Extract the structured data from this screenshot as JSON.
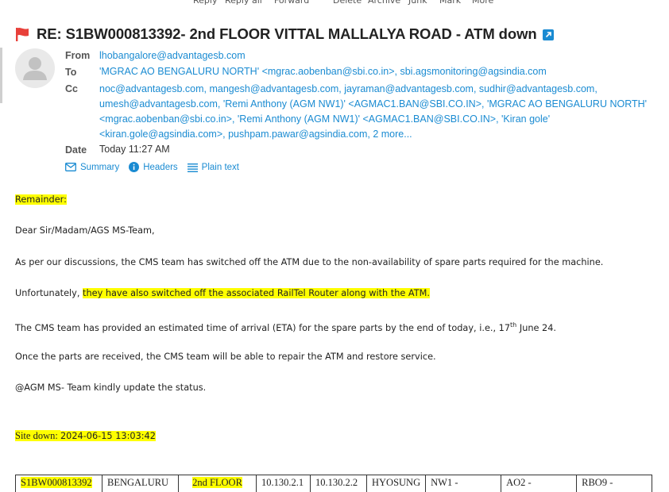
{
  "toolbar": {
    "reply": "Reply",
    "reply_all": "Reply all",
    "forward": "Forward",
    "delete": "Delete",
    "archive": "Archive",
    "junk": "Junk",
    "mark": "Mark",
    "more": "More"
  },
  "message": {
    "subject": "RE: S1BW000813392- 2nd FLOOR VITTAL MALLALYA ROAD - ATM down",
    "from_label": "From",
    "from": "lhobangalore@advantagesb.com",
    "to_label": "To",
    "to": "'MGRAC AO BENGALURU NORTH' <mgrac.aobenban@sbi.co.in>, sbi.agsmonitoring@agsindia.com",
    "cc_label": "Cc",
    "cc_lines": [
      "noc@advantagesb.com, mangesh@advantagesb.com, jayraman@advantagesb.com, sudhir@advantagesb.com,",
      "umesh@advantagesb.com, 'Remi Anthony (AGM NW1)' <AGMAC1.BAN@SBI.CO.IN>, 'MGRAC AO BENGALURU NORTH'",
      "<mgrac.aobenban@sbi.co.in>, 'Remi Anthony (AGM NW1)' <AGMAC1.BAN@SBI.CO.IN>, 'Kiran gole'",
      "<kiran.gole@agsindia.com>, pushpam.pawar@agsindia.com,"
    ],
    "cc_more": "2 more...",
    "date_label": "Date",
    "date": "Today 11:27 AM",
    "links": {
      "summary": "Summary",
      "headers": "Headers",
      "plain_text": "Plain text"
    }
  },
  "body": {
    "remainder": "Remainder:",
    "greeting": "Dear Sir/Madam/AGS MS-Team,",
    "para1": "As per our discussions, the CMS team has switched off the ATM due to the non-availability of spare parts required for the machine.",
    "para2_prefix": "Unfortunately, ",
    "para2_highlight": "they have also switched off the associated RailTel Router along with the ATM.",
    "para3_prefix": "The CMS team has provided an estimated time of arrival (ETA) for the spare parts by the end of today, i.e., 17",
    "para3_sup": "th",
    "para3_suffix": " June 24.",
    "para4": "Once the parts are received, the CMS team will be able to repair the ATM and restore service.",
    "para5": "@AGM MS- Team kindly update the status.",
    "site_down_label": "Site down: ",
    "site_down_value": "2024-06-15 13:03:42"
  },
  "table": {
    "row": [
      "S1BW000813392",
      "BENGALURU",
      "2nd FLOOR",
      "10.130.2.1",
      "10.130.2.2",
      "HYOSUNG",
      "NW1 -",
      "AO2 -",
      "RBO9 -"
    ]
  },
  "colors": {
    "link": "#1a8bd2",
    "flag": "#e8403a",
    "highlight": "#ffff00"
  }
}
